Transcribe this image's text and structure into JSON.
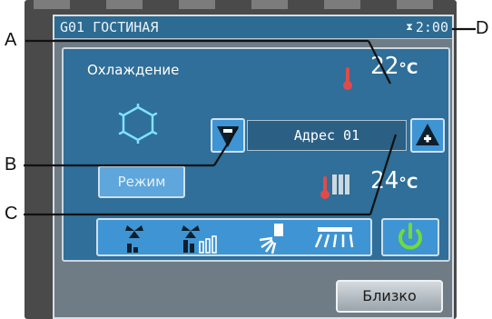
{
  "screen": {
    "title": "G01 ГОСТИНАЯ",
    "timer": "2:00",
    "mode_label": "Охлаждение",
    "room_temp": "22",
    "set_temp": "24",
    "temp_unit": "°C",
    "address": "Адрес 01",
    "mode_button": "Режим",
    "close_button": "Близко"
  },
  "callouts": {
    "a": "A",
    "b": "B",
    "c": "C",
    "d": "D"
  },
  "colors": {
    "panel": "#2f6f99",
    "button": "#3f94d3",
    "power": "#6fdc3a"
  }
}
